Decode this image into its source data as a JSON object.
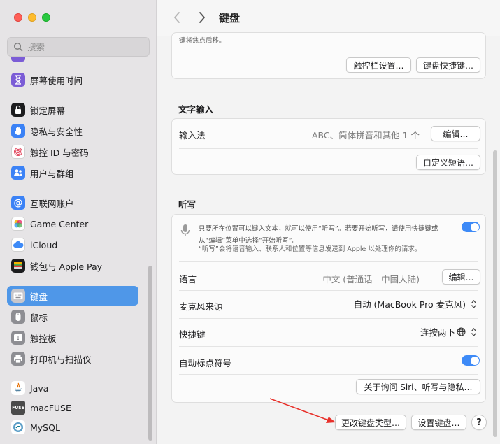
{
  "window": {
    "title": "键盘"
  },
  "search": {
    "placeholder": "搜索"
  },
  "sidebar": {
    "items": [
      {
        "label": "屏幕使用时间",
        "color": "#7b5cd6",
        "icon": "hourglass-icon"
      },
      {
        "label": "锁定屏幕",
        "color": "#1c1c1e",
        "icon": "lock-icon"
      },
      {
        "label": "隐私与安全性",
        "color": "#3b82f6",
        "icon": "hand-icon"
      },
      {
        "label": "触控 ID 与密码",
        "color": "#ffffff",
        "icon": "fingerprint-icon"
      },
      {
        "label": "用户与群组",
        "color": "#3b82f6",
        "icon": "users-icon"
      },
      {
        "label": "互联网账户",
        "color": "#3b82f6",
        "icon": "at-icon"
      },
      {
        "label": "Game Center",
        "color": "#ffffff",
        "icon": "game-center-icon"
      },
      {
        "label": "iCloud",
        "color": "#ffffff",
        "icon": "icloud-icon"
      },
      {
        "label": "钱包与 Apple Pay",
        "color": "#1c1c1e",
        "icon": "wallet-icon"
      },
      {
        "label": "键盘",
        "color": "#8e8e93",
        "icon": "keyboard-icon"
      },
      {
        "label": "鼠标",
        "color": "#8e8e93",
        "icon": "mouse-icon"
      },
      {
        "label": "触控板",
        "color": "#8e8e93",
        "icon": "trackpad-icon"
      },
      {
        "label": "打印机与扫描仪",
        "color": "#8e8e93",
        "icon": "printer-icon"
      },
      {
        "label": "Java",
        "color": "#ffffff",
        "icon": "java-icon"
      },
      {
        "label": "macFUSE",
        "color": "#4a4a4a",
        "icon": "macfuse-icon"
      },
      {
        "label": "MySQL",
        "color": "#ffffff",
        "icon": "mysql-icon"
      }
    ],
    "active": "键盘"
  },
  "top_card": {
    "cut_text": "键将焦点后移。",
    "touchbar_button": "触控栏设置…",
    "shortcuts_button": "键盘快捷键…"
  },
  "text_input": {
    "title": "文字输入",
    "input_method_label": "输入法",
    "input_method_value": "ABC、简体拼音和其他 1 个",
    "edit_button": "编辑…",
    "custom_phrases_button": "自定义短语…"
  },
  "dictation": {
    "title": "听写",
    "description": "只要所在位置可以键入文本，就可以使用“听写”。若要开始听写，请使用快捷键或从“编辑”菜单中选择“开始听写”。",
    "note": "“听写”会将语音输入、联系人和位置等信息发送到 Apple 以处理你的请求。",
    "enabled": true,
    "language_label": "语言",
    "language_value": "中文 (普通话 - 中国大陆)",
    "language_edit_button": "编辑…",
    "mic_label": "麦克风来源",
    "mic_value": "自动 (MacBook Pro 麦克风)",
    "shortcut_label": "快捷键",
    "shortcut_value": "连按两下",
    "auto_punct_label": "自动标点符号",
    "auto_punct_enabled": true,
    "siri_privacy_button": "关于询问 Siri、听写与隐私…"
  },
  "footer": {
    "change_type_button": "更改键盘类型…",
    "setup_button": "设置键盘…",
    "help_button": "?"
  },
  "colors": {
    "accent": "#3d8af7",
    "annotation_arrow": "#e8302a",
    "sidebar_active": "#4f97e8"
  }
}
